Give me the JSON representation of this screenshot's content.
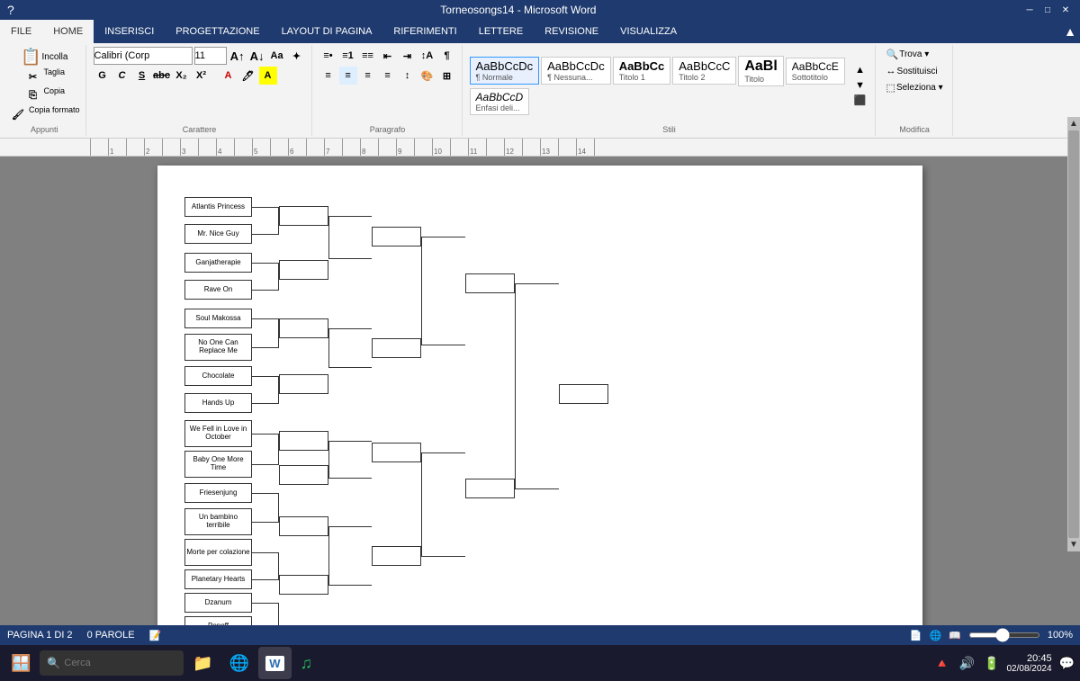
{
  "titlebar": {
    "title": "Torneosongs14 - Microsoft Word",
    "minimize": "─",
    "restore": "□",
    "close": "✕",
    "help": "?"
  },
  "ribbon": {
    "tabs": [
      "FILE",
      "HOME",
      "INSERISCI",
      "PROGETTAZIONE",
      "LAYOUT DI PAGINA",
      "RIFERIMENTI",
      "LETTERE",
      "REVISIONE",
      "VISUALIZZA"
    ],
    "active_tab": "HOME",
    "groups": {
      "appunti": "Appunti",
      "carattere": "Carattere",
      "paragrafo": "Paragrafo",
      "stili": "Stili",
      "modifica": "Modifica"
    },
    "font": {
      "name": "Calibri (Corp",
      "size": "11"
    },
    "styles": [
      {
        "label": "AaBbCcDc",
        "name": "Normale",
        "active": true
      },
      {
        "label": "AaBbCcDc",
        "name": "¶ Nessuna..."
      },
      {
        "label": "AaBbCc",
        "name": "Titolo 1"
      },
      {
        "label": "AaBbCcC",
        "name": "Titolo 2"
      },
      {
        "label": "AaBl",
        "name": "Titolo"
      },
      {
        "label": "AaBbCcE",
        "name": "Sottotitolo"
      },
      {
        "label": "AaBbCcD",
        "name": "Enfasi deli..."
      }
    ],
    "modifica": {
      "trova": "Trova",
      "sostituisci": "Sostituisci",
      "seleziona": "Seleziona"
    }
  },
  "bracket": {
    "round1": [
      "Atlantis Princess",
      "Mr. Nice Guy",
      "Ganjatherapie",
      "Rave On",
      "Soul Makossa",
      "No One Can Replace Me",
      "Chocolate",
      "Hands Up",
      "We Fell in Love in October",
      "Baby One More Time",
      "Friesenjung",
      "Un bambino terribile",
      "Morte per colazione",
      "Planetary Hearts",
      "Dzanum",
      "Popoff"
    ]
  },
  "statusbar": {
    "page": "PAGINA 1 DI 2",
    "words": "0 PAROLE",
    "zoom": "100%"
  },
  "taskbar": {
    "start": "⊞",
    "search_placeholder": "Cerca",
    "time": "20:45",
    "date": "02/08/2024",
    "apps": [
      {
        "icon": "🪟",
        "name": "start-button"
      },
      {
        "icon": "🔍",
        "name": "search-button"
      },
      {
        "icon": "📁",
        "name": "file-explorer"
      },
      {
        "icon": "🌐",
        "name": "chrome-browser"
      },
      {
        "icon": "W",
        "name": "word-taskbar"
      },
      {
        "icon": "🎵",
        "name": "spotify"
      }
    ]
  }
}
